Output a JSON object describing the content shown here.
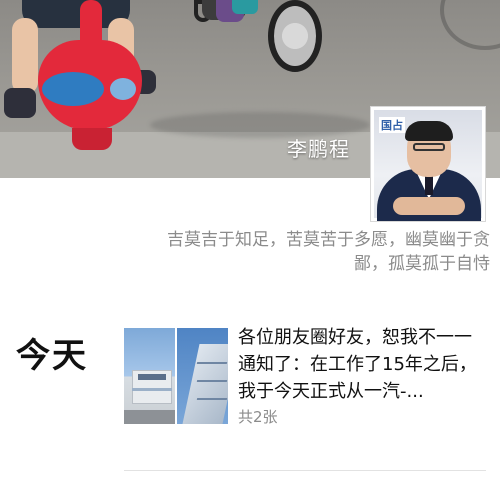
{
  "profile": {
    "name": "李鹏程",
    "signature_lines": [
      "吉莫吉于知足，苦莫苦于多愿，幽莫幽于贪",
      "鄙，孤莫孤于自恃"
    ],
    "avatar_sign_text": "国占"
  },
  "feed": {
    "day_label": "今天",
    "post": {
      "text": "各位朋友圈好友，恕我不一一通知了：在工作了15年之后，我于今天正式从一汽-...",
      "photo_count": "共2张"
    }
  }
}
